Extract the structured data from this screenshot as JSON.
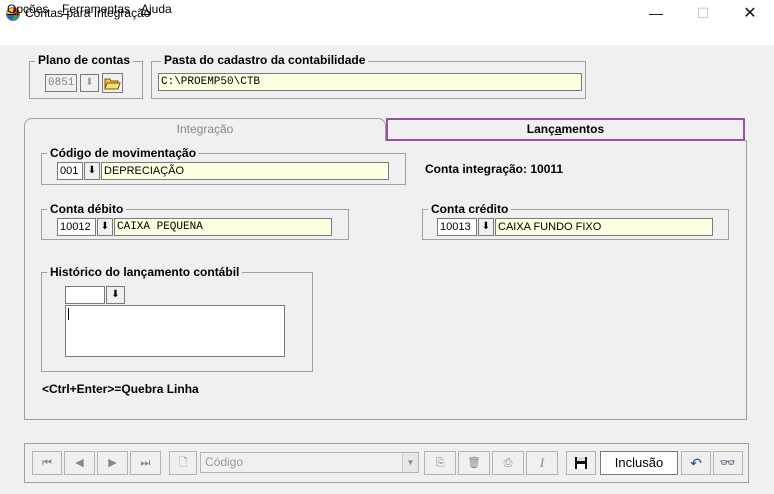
{
  "window": {
    "title": "Contas para Integração",
    "minimize": "—",
    "maximize": "☐",
    "close": "✕"
  },
  "menu": {
    "opcoes": {
      "first": "O",
      "rest": "pções"
    },
    "ferramentas": {
      "first": "F",
      "rest": "erramentas"
    },
    "ajuda": {
      "first": "A",
      "rest": "juda"
    }
  },
  "plano": {
    "title": "Plano de contas",
    "value": "0851"
  },
  "pasta": {
    "title": "Pasta do cadastro da contabilidade",
    "value": "C:\\PROEMP50\\CTB"
  },
  "tabs": {
    "integracao": "Integração",
    "lancamentos": {
      "pre": "Lanç",
      "ul": "a",
      "post": "mentos"
    }
  },
  "movimentacao": {
    "title": "Código de movimentação",
    "code": "001",
    "desc": "DEPRECIAÇÃO"
  },
  "conta_integracao": "Conta integração: 10011",
  "debito": {
    "title": "Conta débito",
    "code": "10012",
    "desc": "CAIXA PEQUENA"
  },
  "credito": {
    "title": "Conta crédito",
    "code": "10013",
    "desc": "CAIXA FUNDO FIXO"
  },
  "historico": {
    "title": "Histórico do lançamento contábil",
    "code": "",
    "text": ""
  },
  "hint": "<Ctrl+Enter>=Quebra Linha",
  "toolbar": {
    "search_placeholder": "Código",
    "mode": "Inclusão"
  },
  "colors": {
    "field_bg": "#ffffe1",
    "active_tab_border": "#9b4ea8"
  }
}
